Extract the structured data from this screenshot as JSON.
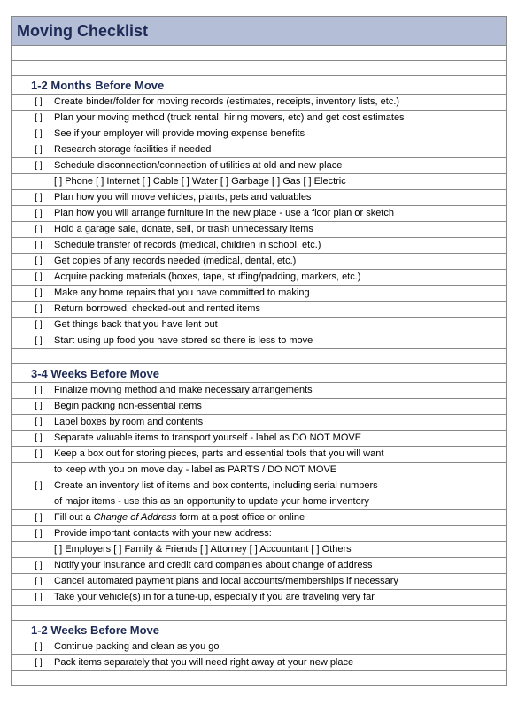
{
  "title": "Moving Checklist",
  "checkbox_glyph": "[   ]",
  "sections": [
    {
      "heading": "1-2 Months Before Move",
      "items": [
        {
          "text": "Create binder/folder for moving records (estimates, receipts, inventory lists, etc.)"
        },
        {
          "text": "Plan your moving method (truck rental, hiring movers, etc) and get cost estimates"
        },
        {
          "text": "See if your employer will provide moving expense benefits"
        },
        {
          "text": "Research storage facilities if needed"
        },
        {
          "text": "Schedule disconnection/connection of utilities at old and new place",
          "sub": "[   ] Phone   [   ] Internet   [   ] Cable   [   ] Water   [   ] Garbage   [   ] Gas   [   ] Electric"
        },
        {
          "text": "Plan how you will move vehicles, plants, pets and valuables"
        },
        {
          "text": "Plan how you will arrange furniture in the new place - use a floor plan or sketch"
        },
        {
          "text": "Hold a garage sale, donate, sell, or trash unnecessary items"
        },
        {
          "text": "Schedule transfer of records (medical, children in school, etc.)"
        },
        {
          "text": "Get copies of any records needed (medical, dental, etc.)"
        },
        {
          "text": "Acquire packing materials (boxes, tape, stuffing/padding, markers, etc.)"
        },
        {
          "text": "Make any home repairs that you have committed to making"
        },
        {
          "text": "Return borrowed, checked-out and rented items"
        },
        {
          "text": "Get things back that you have lent out"
        },
        {
          "text": "Start using up food you have stored so there is less to move"
        }
      ]
    },
    {
      "heading": "3-4 Weeks Before Move",
      "items": [
        {
          "text": "Finalize moving method and make necessary arrangements"
        },
        {
          "text": "Begin packing non-essential items"
        },
        {
          "text": "Label boxes by room and contents"
        },
        {
          "text": "Separate valuable items to transport yourself - label as DO NOT MOVE"
        },
        {
          "text": "Keep a box out for storing pieces, parts and essential tools that you will want",
          "cont": "to keep with you on move day - label as PARTS / DO NOT MOVE"
        },
        {
          "text": "Create an inventory list of items and box contents, including serial numbers",
          "cont": "of major items - use this as an opportunity to update your home inventory"
        },
        {
          "text_html": "Fill out a <span class=\"italic\">Change of Address</span> form at a post office or online"
        },
        {
          "text": "Provide important contacts with your new address:",
          "sub": "[   ] Employers   [   ] Family & Friends   [   ] Attorney   [   ] Accountant   [   ] Others"
        },
        {
          "text": "Notify your insurance and credit card companies about change of address"
        },
        {
          "text": "Cancel automated payment plans and local accounts/memberships if necessary"
        },
        {
          "text": "Take your vehicle(s) in for a tune-up, especially if you are traveling very far"
        }
      ]
    },
    {
      "heading": "1-2 Weeks Before Move",
      "items": [
        {
          "text": "Continue packing and clean as you go"
        },
        {
          "text": "Pack items separately that you will need right away at your new place"
        }
      ]
    }
  ]
}
